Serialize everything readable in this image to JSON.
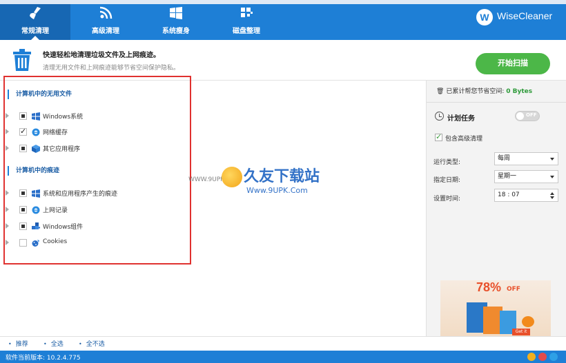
{
  "tabs": [
    {
      "label": "常规清理",
      "icon": "broom-icon",
      "active": true
    },
    {
      "label": "高级清理",
      "icon": "rss-broom-icon",
      "active": false
    },
    {
      "label": "系统瘦身",
      "icon": "windows-icon",
      "active": false
    },
    {
      "label": "磁盘整理",
      "icon": "defrag-icon",
      "active": false
    }
  ],
  "brand": {
    "logo_letter": "W",
    "name": "WiseCleaner"
  },
  "subheader": {
    "title": "快速轻松地清理垃圾文件及上网痕迹。",
    "description": "清理无用文件和上网痕迹能够节省空间保护隐私。",
    "scan_button": "开始扫描"
  },
  "sections": {
    "useless": "计算机中的无用文件",
    "traces": "计算机中的痕迹"
  },
  "useless_items": [
    {
      "label": "Windows系统",
      "state": "partial",
      "icon": "windows-icon"
    },
    {
      "label": "网络缓存",
      "state": "checked",
      "icon": "ie-icon"
    },
    {
      "label": "其它应用程序",
      "state": "partial",
      "icon": "cube-icon"
    }
  ],
  "trace_items": [
    {
      "label": "系统和应用程序产生的痕迹",
      "state": "partial",
      "icon": "windows-icon"
    },
    {
      "label": "上网记录",
      "state": "partial",
      "icon": "ie-icon"
    },
    {
      "label": "Windows组件",
      "state": "partial",
      "icon": "puzzle-icon"
    },
    {
      "label": "Cookies",
      "state": "unchecked",
      "icon": "cookie-icon"
    }
  ],
  "watermark": {
    "url": "WWW.9UPK.COM",
    "title": "久友下载站",
    "subtitle": "Www.9UPK.Com"
  },
  "right": {
    "saved_label": "已累计帮您节省空间:",
    "saved_value": "0 Bytes",
    "schedule_title": "计划任务",
    "toggle_text": "OFF",
    "include_advanced": "包含高级清理",
    "run_type_label": "运行类型:",
    "run_type_value": "每周",
    "date_label": "指定日期:",
    "date_value": "星期一",
    "time_label": "设置时间:",
    "time_value": "18 : 07"
  },
  "ad": {
    "percent": "78%",
    "off": "OFF",
    "cta": "Get it now"
  },
  "bottom_links": [
    "推荐",
    "全选",
    "全不选"
  ],
  "status": {
    "version": "软件当前版本: 10.2.4.775"
  },
  "colors": {
    "header": "#1e7fd6",
    "active_tab": "#1767b3",
    "scan": "#4cb748",
    "highlight_box": "#e0312f"
  }
}
